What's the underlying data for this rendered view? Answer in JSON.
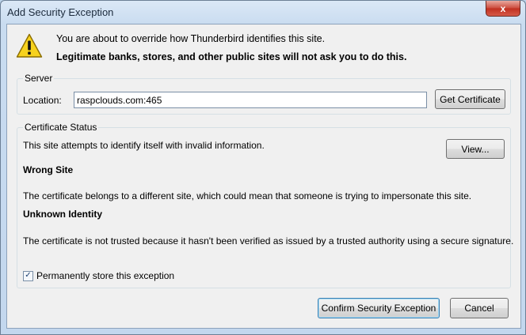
{
  "window": {
    "title": "Add Security Exception",
    "close_symbol": "x"
  },
  "warning": {
    "icon": "warning-icon",
    "line1": "You are about to override how Thunderbird identifies this site.",
    "line2": "Legitimate banks, stores, and other public sites will not ask you to do this."
  },
  "server": {
    "legend": "Server",
    "location_label": "Location:",
    "location_value": "raspclouds.com:465",
    "get_certificate_label": "Get Certificate"
  },
  "certificate_status": {
    "legend": "Certificate Status",
    "intro": "This site attempts to identify itself with invalid information.",
    "view_label": "View...",
    "issue1_title": "Wrong Site",
    "issue1_text": "The certificate belongs to a different site, which could mean that someone is trying to impersonate this site.",
    "issue2_title": "Unknown Identity",
    "issue2_text": "The certificate is not trusted because it hasn't been verified as issued by a trusted authority using a secure signature.",
    "permanent_label": "Permanently store this exception",
    "permanent_checked": true
  },
  "buttons": {
    "confirm_label": "Confirm Security Exception",
    "cancel_label": "Cancel"
  },
  "colors": {
    "warning_yellow": "#f7d21e",
    "accent_blue": "#3c7fb1",
    "close_red": "#c02f20"
  }
}
